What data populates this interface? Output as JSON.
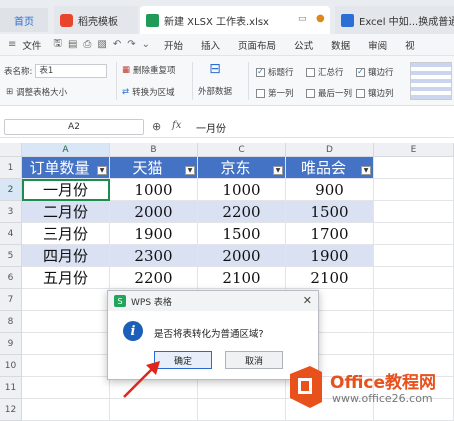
{
  "tabs": {
    "home": "首页",
    "template": "稻壳模板",
    "active": "新建 XLSX 工作表.xlsx",
    "other": "Excel 中如...换成普通数"
  },
  "menu": {
    "file": "文件",
    "items": [
      "开始",
      "插入",
      "页面布局",
      "公式",
      "数据",
      "审阅",
      "视"
    ]
  },
  "ribbon": {
    "table_name_label": "表名称:",
    "table_name_value": "表1",
    "resize": "调整表格大小",
    "remove_dup": "删除重复项",
    "convert_range": "转换为区域",
    "external_data": "外部数据",
    "header_row": "标题行",
    "total_row": "汇总行",
    "banded_rows": "镶边行",
    "first_col": "第一列",
    "last_col": "最后一列",
    "banded_cols": "镶边列"
  },
  "formula_bar": {
    "cell_ref": "A2",
    "fx": "fx",
    "content": "一月份"
  },
  "columns": [
    "A",
    "B",
    "C",
    "D",
    "E"
  ],
  "rows": [
    "1",
    "2",
    "3",
    "4",
    "5",
    "6",
    "7",
    "8",
    "9",
    "10",
    "11",
    "12"
  ],
  "table": {
    "headers": [
      "订单数量",
      "天猫",
      "京东",
      "唯品会"
    ],
    "data": [
      [
        "一月份",
        "1000",
        "1000",
        "900"
      ],
      [
        "二月份",
        "2000",
        "2200",
        "1500"
      ],
      [
        "三月份",
        "1900",
        "1500",
        "1700"
      ],
      [
        "四月份",
        "2300",
        "2000",
        "1900"
      ],
      [
        "五月份",
        "2200",
        "2100",
        "2100"
      ]
    ]
  },
  "dialog": {
    "title": "WPS 表格",
    "message": "是否将表转化为普通区域?",
    "ok": "确定",
    "cancel": "取消"
  },
  "watermark": {
    "brand": "Office教程网",
    "url": "www.office26.com"
  },
  "colors": {
    "table_header": "#4472c4",
    "band": "#d9e1f2",
    "accent_green": "#1e8c4f",
    "arrow": "#e0261b"
  }
}
